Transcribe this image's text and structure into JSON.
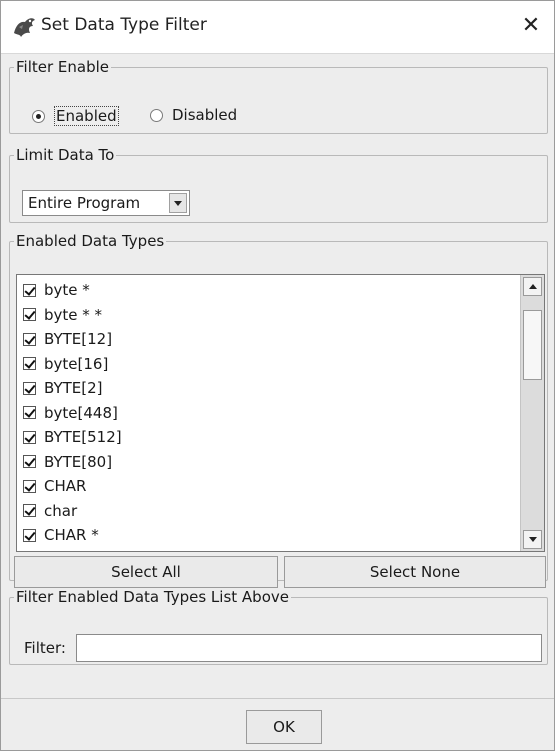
{
  "window": {
    "title": "Set Data Type Filter"
  },
  "filter_enable": {
    "legend": "Filter Enable",
    "options": [
      {
        "label": "Enabled",
        "selected": true
      },
      {
        "label": "Disabled",
        "selected": false
      }
    ]
  },
  "limit": {
    "legend": "Limit Data To",
    "selected": "Entire Program"
  },
  "types": {
    "legend": "Enabled Data Types",
    "items": [
      {
        "label": "byte *",
        "checked": true
      },
      {
        "label": "byte * *",
        "checked": true
      },
      {
        "label": "BYTE[12]",
        "checked": true
      },
      {
        "label": "byte[16]",
        "checked": true
      },
      {
        "label": "BYTE[2]",
        "checked": true
      },
      {
        "label": "byte[448]",
        "checked": true
      },
      {
        "label": "BYTE[512]",
        "checked": true
      },
      {
        "label": "BYTE[80]",
        "checked": true
      },
      {
        "label": "CHAR",
        "checked": true
      },
      {
        "label": "char",
        "checked": true
      },
      {
        "label": "CHAR *",
        "checked": true
      }
    ],
    "select_all": "Select All",
    "select_none": "Select None"
  },
  "filter": {
    "legend": "Filter Enabled Data Types List Above",
    "label": "Filter:",
    "value": ""
  },
  "ok": "OK"
}
